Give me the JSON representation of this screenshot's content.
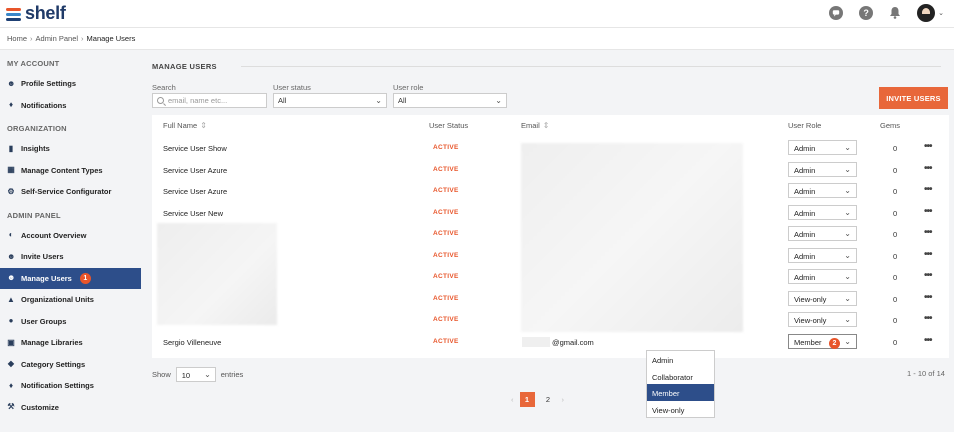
{
  "app": {
    "logo_text": "shelf"
  },
  "topbar": {
    "help_glyph": "?"
  },
  "breadcrumb": [
    "Home",
    "Admin Panel",
    "Manage Users"
  ],
  "sidebar": {
    "sections": [
      {
        "title": "MY ACCOUNT",
        "items": [
          {
            "label": "Profile Settings",
            "icon": "person-gear-icon"
          },
          {
            "label": "Notifications",
            "icon": "bell-icon"
          }
        ]
      },
      {
        "title": "ORGANIZATION",
        "items": [
          {
            "label": "Insights",
            "icon": "bar-chart-icon"
          },
          {
            "label": "Manage Content Types",
            "icon": "grid-icon"
          },
          {
            "label": "Self-Service Configurator",
            "icon": "gear-icon"
          }
        ]
      },
      {
        "title": "ADMIN PANEL",
        "items": [
          {
            "label": "Account Overview",
            "icon": "pie-chart-icon"
          },
          {
            "label": "Invite Users",
            "icon": "person-plus-icon"
          },
          {
            "label": "Manage Users",
            "icon": "users-icon",
            "active": true,
            "badge": "1"
          },
          {
            "label": "Organizational Units",
            "icon": "org-chart-icon"
          },
          {
            "label": "User Groups",
            "icon": "group-icon"
          },
          {
            "label": "Manage Libraries",
            "icon": "library-icon"
          },
          {
            "label": "Category Settings",
            "icon": "category-icon"
          },
          {
            "label": "Notification Settings",
            "icon": "bell-settings-icon"
          },
          {
            "label": "Customize",
            "icon": "tools-icon"
          }
        ]
      }
    ]
  },
  "main": {
    "title": "MANAGE USERS",
    "filters": {
      "search_label": "Search",
      "search_placeholder": "email, name etc...",
      "status_label": "User status",
      "status_value": "All",
      "role_label": "User role",
      "role_value": "All"
    },
    "invite_button": "INVITE USERS",
    "columns": {
      "full_name": "Full Name",
      "status": "User Status",
      "email": "Email",
      "role": "User Role",
      "gems": "Gems"
    },
    "rows": [
      {
        "name": "Service User Show",
        "status": "ACTIVE",
        "email": "",
        "role": "Admin",
        "gems": "0"
      },
      {
        "name": "Service User Azure",
        "status": "ACTIVE",
        "email": "",
        "role": "Admin",
        "gems": "0"
      },
      {
        "name": "Service User Azure",
        "status": "ACTIVE",
        "email": "",
        "role": "Admin",
        "gems": "0"
      },
      {
        "name": "Service User New",
        "status": "ACTIVE",
        "email": "",
        "role": "Admin",
        "gems": "0"
      },
      {
        "name": "",
        "status": "ACTIVE",
        "email": "",
        "role": "Admin",
        "gems": "0"
      },
      {
        "name": "",
        "status": "ACTIVE",
        "email": "",
        "role": "Admin",
        "gems": "0"
      },
      {
        "name": "",
        "status": "ACTIVE",
        "email": "",
        "role": "Admin",
        "gems": "0"
      },
      {
        "name": "",
        "status": "ACTIVE",
        "email": "",
        "role": "View-only",
        "gems": "0"
      },
      {
        "name": "",
        "status": "ACTIVE",
        "email": "",
        "role": "View-only",
        "gems": "0"
      },
      {
        "name": "Sergio Villeneuve",
        "status": "ACTIVE",
        "email": "@gmail.com",
        "role": "Member",
        "gems": "0"
      }
    ],
    "open_dropdown_badge": "2",
    "role_options": [
      "Admin",
      "Collaborator",
      "Member",
      "View-only"
    ],
    "role_options_selected": "Member",
    "show_label": "Show",
    "show_value": "10",
    "entries_label": "entries",
    "range_text": "1 - 10 of 14",
    "pages": [
      "1",
      "2"
    ],
    "current_page": "1",
    "more_glyph": "•••"
  }
}
